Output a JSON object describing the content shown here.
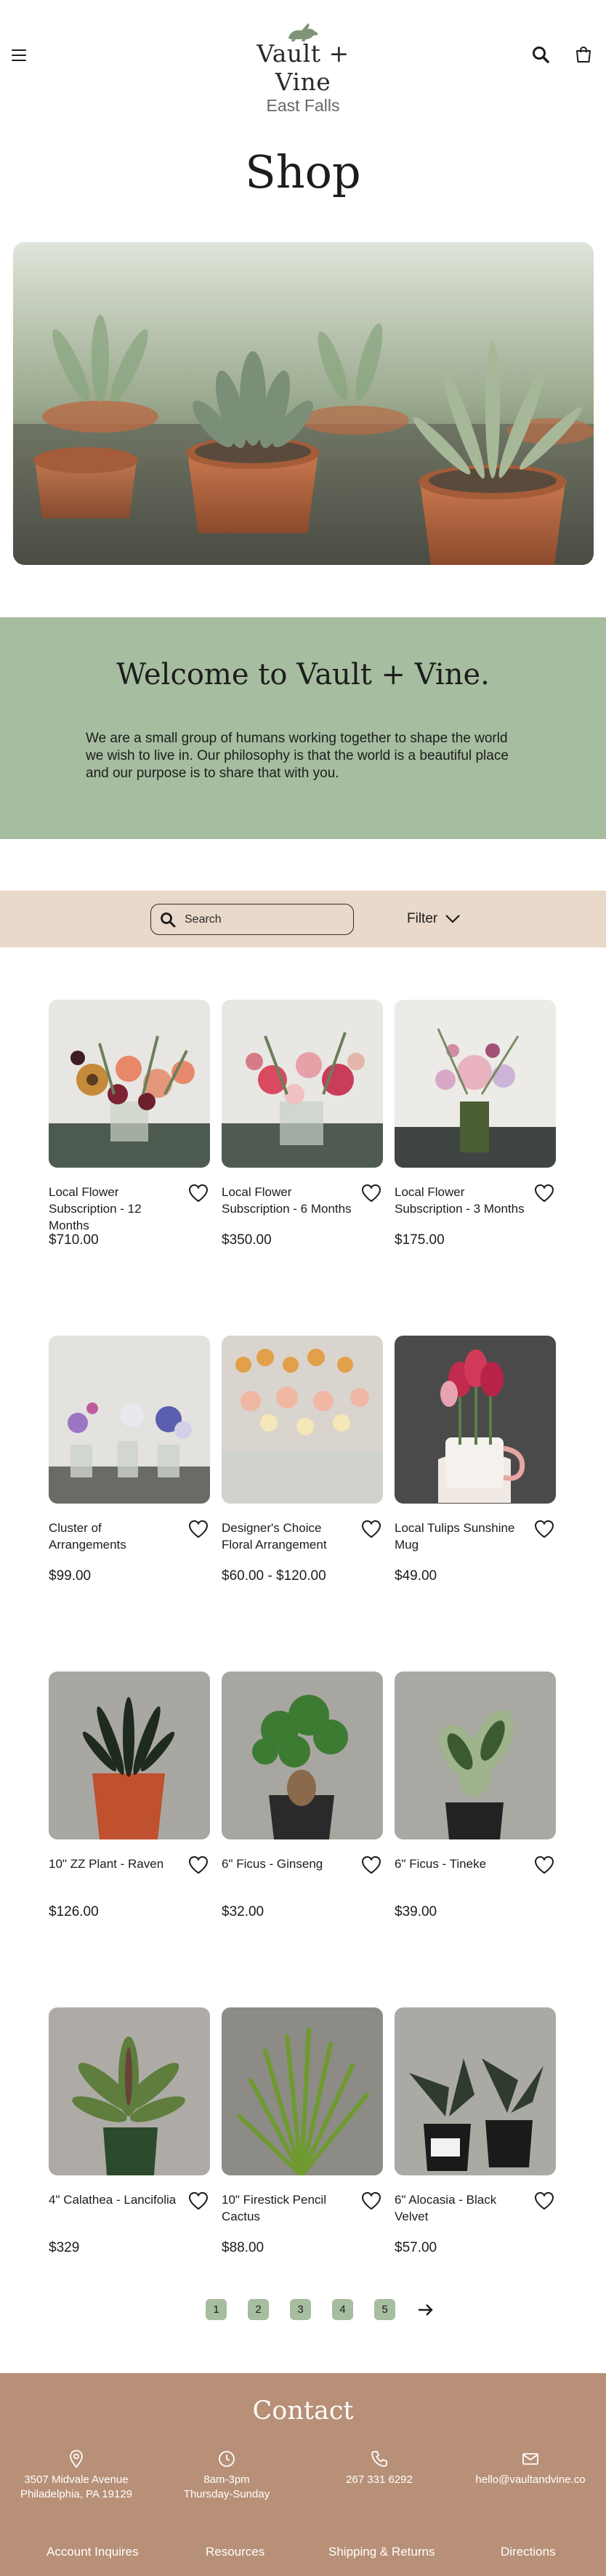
{
  "header": {
    "brand": "Vault + Vine",
    "location": "East Falls",
    "icons": {
      "menu": "menu-icon",
      "search": "search-icon",
      "cart": "shopping-bag-icon",
      "logo": "rabbit-logo-icon"
    }
  },
  "page_title": "Shop",
  "hero": {
    "image": "potted succulents photo"
  },
  "welcome": {
    "heading": "Welcome to Vault + Vine.",
    "body": "We are a small group of humans working together to shape the world we wish to live in. Our philosophy is that the world is a beautiful place and our purpose is to share that with you."
  },
  "search": {
    "placeholder": "Search",
    "value": ""
  },
  "filter": {
    "label": "Filter"
  },
  "products": [
    {
      "name": "Local Flower Subscription - 12 Months",
      "price": "$710.00"
    },
    {
      "name": "Local Flower Subscription - 6 Months",
      "price": "$350.00"
    },
    {
      "name": "Local Flower Subscription - 3 Months",
      "price": "$175.00"
    },
    {
      "name": "Cluster of Arrangements",
      "price": "$99.00"
    },
    {
      "name": "Designer's Choice Floral Arrangement",
      "price": "$60.00 - $120.00"
    },
    {
      "name": "Local Tulips Sunshine Mug",
      "price": "$49.00"
    },
    {
      "name": "10\" ZZ Plant - Raven",
      "price": "$126.00"
    },
    {
      "name": "6\" Ficus - Ginseng",
      "price": "$32.00"
    },
    {
      "name": "6\" Ficus - Tineke",
      "price": "$39.00"
    },
    {
      "name": "4\" Calathea - Lancifolia",
      "price": "$329"
    },
    {
      "name": "10\" Firestick Pencil Cactus",
      "price": "$88.00"
    },
    {
      "name": "6\" Alocasia - Black Velvet",
      "price": "$57.00"
    }
  ],
  "pagination": {
    "pages": [
      "1",
      "2",
      "3",
      "4",
      "5"
    ],
    "next_icon": "arrow-right-icon"
  },
  "footer": {
    "heading": "Contact",
    "address_line1": "3507 Midvale Avenue",
    "address_line2": "Philadelphia, PA 19129",
    "hours_line1": "8am-3pm",
    "hours_line2": "Thursday-Sunday",
    "phone": "267 331 6292",
    "email": "hello@vaultandvine.co",
    "links": [
      "Account Inquires",
      "Resources",
      "Shipping & Returns",
      "Directions"
    ]
  },
  "colors": {
    "sage": "#a6bd9f",
    "sand": "#e9d9ca",
    "terracotta": "#b89077"
  }
}
